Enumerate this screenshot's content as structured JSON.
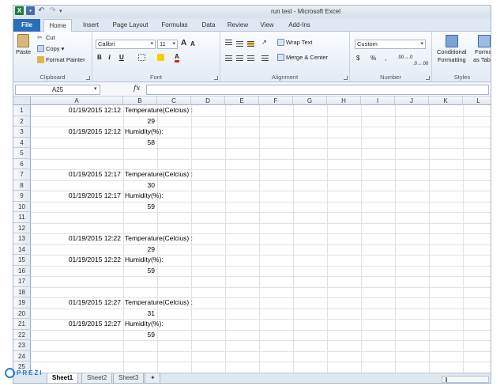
{
  "app": {
    "title": "run test - Microsoft Excel"
  },
  "ribbon_tabs": [
    "File",
    "Home",
    "Insert",
    "Page Layout",
    "Formulas",
    "Data",
    "Review",
    "View",
    "Add-Ins"
  ],
  "clipboard": {
    "paste": "Paste",
    "cut": "Cut",
    "copy": "Copy",
    "copy_arrow": "▾",
    "format_painter": "Format Painter",
    "label": "Clipboard"
  },
  "font": {
    "name": "Calibri",
    "size": "11",
    "grow": "A",
    "shrink": "A",
    "bold": "B",
    "italic": "I",
    "underline": "U",
    "color_letter": "A",
    "label": "Font"
  },
  "alignment": {
    "wrap_text": "Wrap Text",
    "merge_center": "Merge & Center",
    "label": "Alignment"
  },
  "number": {
    "format": "Custom",
    "currency": "$",
    "percent": "%",
    "comma": ",",
    "inc_decimal": ".00→.0",
    "dec_decimal": ".0→.00",
    "label": "Number"
  },
  "styles": {
    "conditional": "Conditional",
    "conditional_sub": "Formatting",
    "format_as": "Format",
    "format_as_sub": "as Table",
    "label": "Styles"
  },
  "formula_bar": {
    "name_box": "A25",
    "fx": "fx",
    "formula": ""
  },
  "grid": {
    "columns": [
      "A",
      "B",
      "C",
      "D",
      "E",
      "F",
      "G",
      "H",
      "I",
      "J",
      "K",
      "L"
    ],
    "rows": [
      "1",
      "2",
      "3",
      "4",
      "5",
      "6",
      "7",
      "8",
      "9",
      "10",
      "11",
      "12",
      "13",
      "14",
      "15",
      "16",
      "17",
      "18",
      "19",
      "20",
      "21",
      "22",
      "23",
      "24",
      "25"
    ],
    "cells": [
      {
        "row": 1,
        "col": "A",
        "text": "01/19/2015 12:12"
      },
      {
        "row": 1,
        "col": "B",
        "text": "Temperature(Celcius) :"
      },
      {
        "row": 2,
        "col": "B",
        "text": "29"
      },
      {
        "row": 3,
        "col": "A",
        "text": "01/19/2015 12:12"
      },
      {
        "row": 3,
        "col": "B",
        "text": "Humidity(%):"
      },
      {
        "row": 4,
        "col": "B",
        "text": "58"
      },
      {
        "row": 7,
        "col": "A",
        "text": "01/19/2015 12:17"
      },
      {
        "row": 7,
        "col": "B",
        "text": "Temperature(Celcius) :"
      },
      {
        "row": 8,
        "col": "B",
        "text": "30"
      },
      {
        "row": 9,
        "col": "A",
        "text": "01/19/2015 12:17"
      },
      {
        "row": 9,
        "col": "B",
        "text": "Humidity(%):"
      },
      {
        "row": 10,
        "col": "B",
        "text": "59"
      },
      {
        "row": 13,
        "col": "A",
        "text": "01/19/2015 12:22"
      },
      {
        "row": 13,
        "col": "B",
        "text": "Temperature(Celcius) :"
      },
      {
        "row": 14,
        "col": "B",
        "text": "29"
      },
      {
        "row": 15,
        "col": "A",
        "text": "01/19/2015 12:22"
      },
      {
        "row": 15,
        "col": "B",
        "text": "Humidity(%):"
      },
      {
        "row": 16,
        "col": "B",
        "text": "59"
      },
      {
        "row": 19,
        "col": "A",
        "text": "01/19/2015 12:27"
      },
      {
        "row": 19,
        "col": "B",
        "text": "Temperature(Celcius) :"
      },
      {
        "row": 20,
        "col": "B",
        "text": "31"
      },
      {
        "row": 21,
        "col": "A",
        "text": "01/19/2015 12:27"
      },
      {
        "row": 21,
        "col": "B",
        "text": "Humidity(%):"
      },
      {
        "row": 22,
        "col": "B",
        "text": "59"
      }
    ]
  },
  "sheets": [
    "Sheet1",
    "Sheet2",
    "Sheet3"
  ],
  "active_sheet": "Sheet1",
  "watermark": {
    "text": "PREZI"
  },
  "colors": {
    "file_tab": "#2a6eb8",
    "excel_green": "#1f7a3d",
    "prezi_blue": "#2b7fd4"
  }
}
